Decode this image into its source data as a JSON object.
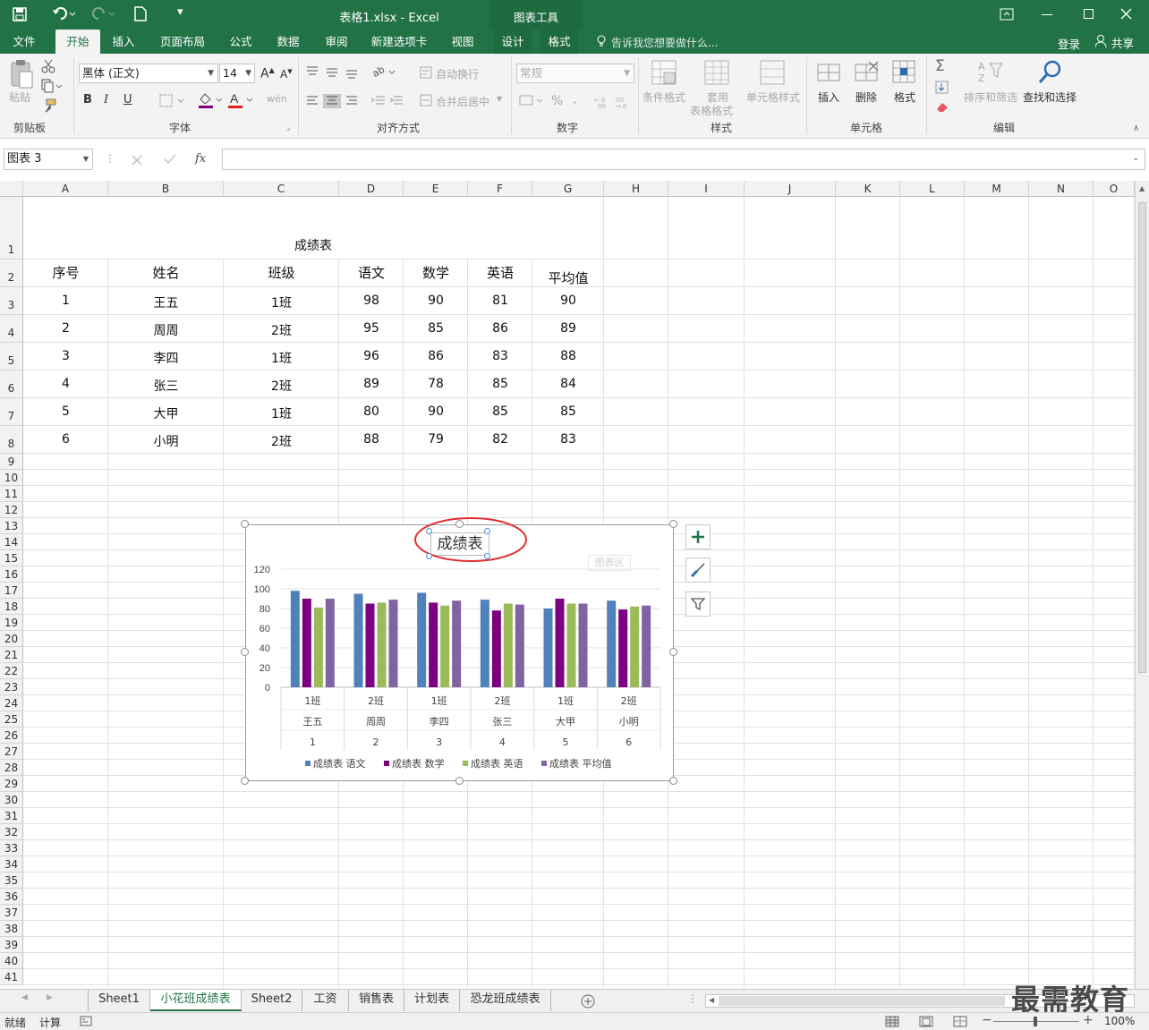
{
  "window": {
    "title": "表格1.xlsx - Excel",
    "chart_tools": "图表工具"
  },
  "tabs": [
    "文件",
    "开始",
    "插入",
    "页面布局",
    "公式",
    "数据",
    "审阅",
    "新建选项卡",
    "视图",
    "设计",
    "格式"
  ],
  "tell_me": "告诉我您想要做什么...",
  "login": "登录",
  "share": "共享",
  "ribbon": {
    "clipboard": {
      "group": "剪贴板",
      "paste": "粘贴"
    },
    "font": {
      "group": "字体",
      "name": "黑体 (正文)",
      "size": "14",
      "bold": "B",
      "italic": "I",
      "underline": "U"
    },
    "align": {
      "group": "对齐方式",
      "wrap": "自动换行",
      "merge": "合并后居中"
    },
    "number": {
      "group": "数字",
      "format": "常规",
      "percent": "%"
    },
    "styles": {
      "group": "样式",
      "cond": "条件格式",
      "table_l1": "套用",
      "table_l2": "表格格式",
      "cell": "单元格样式"
    },
    "cells": {
      "group": "单元格",
      "insert": "插入",
      "delete": "删除",
      "format": "格式"
    },
    "edit": {
      "group": "编辑",
      "sort": "排序和筛选",
      "find": "查找和选择"
    }
  },
  "formula_bar": {
    "name_box": "图表 3",
    "fx": "fx",
    "value": ""
  },
  "columns": [
    "A",
    "B",
    "C",
    "D",
    "E",
    "F",
    "G",
    "H",
    "I",
    "J",
    "K",
    "L",
    "M",
    "N",
    "O"
  ],
  "rows": [
    "1",
    "2",
    "3",
    "4",
    "5",
    "6",
    "7",
    "8",
    "9",
    "10",
    "11",
    "12",
    "13",
    "14",
    "15",
    "16",
    "17",
    "18",
    "19",
    "20",
    "21",
    "22",
    "23",
    "24",
    "25",
    "26",
    "27",
    "28",
    "29",
    "30",
    "31",
    "32",
    "33",
    "34",
    "35",
    "36",
    "37",
    "38",
    "39",
    "40",
    "41"
  ],
  "sheet": {
    "title": "成绩表",
    "headers": [
      "序号",
      "姓名",
      "班级",
      "语文",
      "数学",
      "英语",
      "平均值"
    ],
    "data": [
      [
        "1",
        "王五",
        "1班",
        "98",
        "90",
        "81",
        "90"
      ],
      [
        "2",
        "周周",
        "2班",
        "95",
        "85",
        "86",
        "89"
      ],
      [
        "3",
        "李四",
        "1班",
        "96",
        "86",
        "83",
        "88"
      ],
      [
        "4",
        "张三",
        "2班",
        "89",
        "78",
        "85",
        "84"
      ],
      [
        "5",
        "大甲",
        "1班",
        "80",
        "90",
        "85",
        "85"
      ],
      [
        "6",
        "小明",
        "2班",
        "88",
        "79",
        "82",
        "83"
      ]
    ]
  },
  "chart_data": {
    "type": "bar",
    "title": "成绩表",
    "tooltip": "图表区",
    "ylim": [
      0,
      120
    ],
    "yticks": [
      "0",
      "20",
      "40",
      "60",
      "80",
      "100",
      "120"
    ],
    "categories": [
      [
        "1班",
        "王五",
        "1"
      ],
      [
        "2班",
        "周周",
        "2"
      ],
      [
        "1班",
        "李四",
        "3"
      ],
      [
        "2班",
        "张三",
        "4"
      ],
      [
        "1班",
        "大甲",
        "5"
      ],
      [
        "2班",
        "小明",
        "6"
      ]
    ],
    "series": [
      {
        "name": "成绩表 语文",
        "color": "#4f81bd",
        "values": [
          98,
          95,
          96,
          89,
          80,
          88
        ]
      },
      {
        "name": "成绩表 数学",
        "color": "#7d0080",
        "values": [
          90,
          85,
          86,
          78,
          90,
          79
        ]
      },
      {
        "name": "成绩表 英语",
        "color": "#9bbb59",
        "values": [
          81,
          86,
          83,
          85,
          85,
          82
        ]
      },
      {
        "name": "成绩表 平均值",
        "color": "#8064a2",
        "values": [
          90,
          89,
          88,
          84,
          85,
          83
        ]
      }
    ],
    "legend": "bottom",
    "grid": true
  },
  "sheet_tabs": [
    "Sheet1",
    "小花班成绩表",
    "Sheet2",
    "工资",
    "销售表",
    "计划表",
    "恐龙班成绩表"
  ],
  "active_sheet": "小花班成绩表",
  "status": {
    "ready": "就绪",
    "calc": "计算",
    "zoom": "100%"
  },
  "watermark": "最需教育",
  "colors": {
    "excel_green": "#217346"
  }
}
